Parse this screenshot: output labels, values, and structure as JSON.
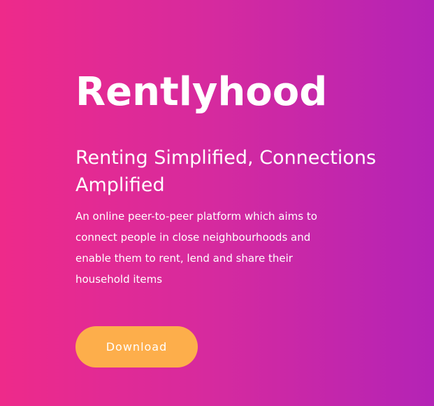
{
  "hero": {
    "title": "Rentlyhood",
    "tagline": "Renting Simplified, Connections Amplified",
    "description": "An online peer-to-peer platform which aims to connect people in close neighbourhoods and enable them to rent, lend and share their household items",
    "download_label": "Download"
  },
  "colors": {
    "gradient_start": "#ee2a8a",
    "gradient_end": "#b423b6",
    "button": "#fdae4b",
    "text": "#ffffff"
  }
}
